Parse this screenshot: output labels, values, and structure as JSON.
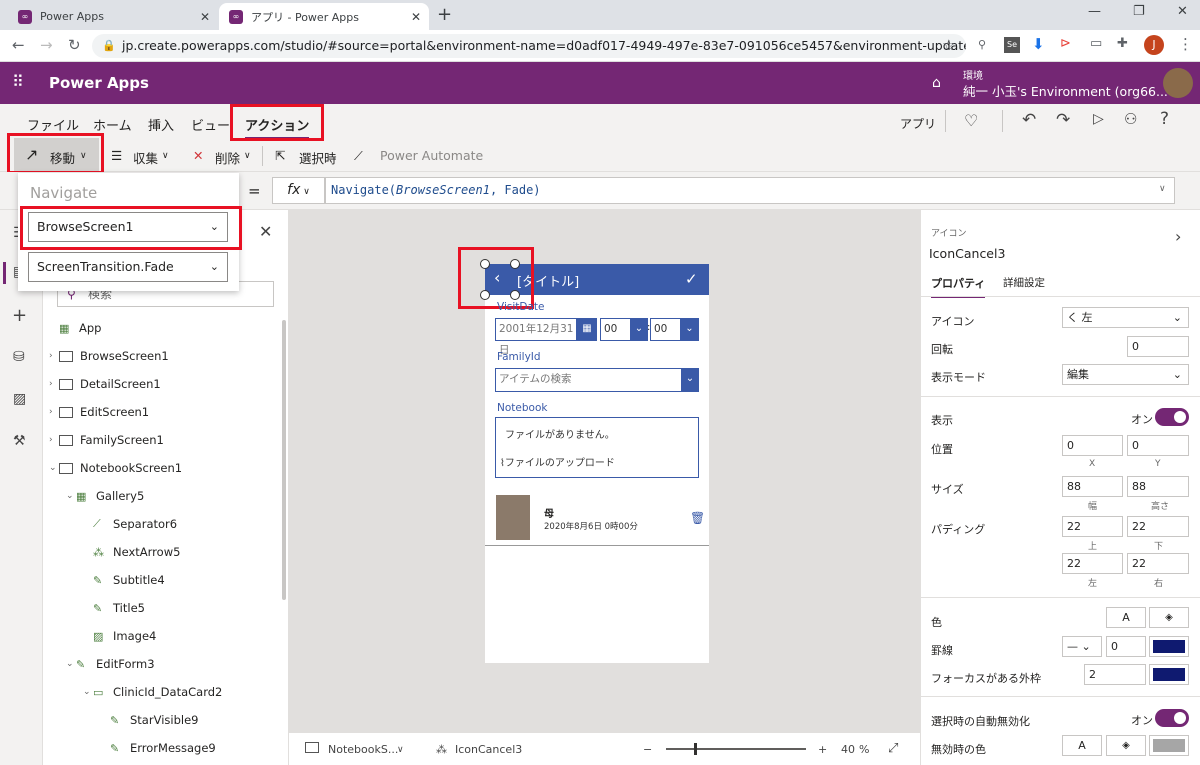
{
  "browser": {
    "tabs": [
      {
        "title": "Power Apps"
      },
      {
        "title": "アプリ - Power Apps"
      }
    ],
    "url": "jp.create.powerapps.com/studio/#source=portal&environment-name=d0adf017-4949-497e-83e7-091056ce5457&environment-update-cadence=...",
    "profile_initial": "J"
  },
  "header": {
    "app_title": "Power Apps",
    "env_label": "環境",
    "env_name": "純一 小玉's Environment (org66..."
  },
  "menu": {
    "items": [
      "ファイル",
      "ホーム",
      "挿入",
      "ビュー",
      "アクション"
    ],
    "right_label": "アプリ"
  },
  "toolbar": {
    "navigate": "移動",
    "collect": "収集",
    "delete": "削除",
    "onselect": "選択時",
    "power_automate": "Power Automate"
  },
  "formula": {
    "eq": "=",
    "fx": "fx",
    "func": "Navigate(",
    "arg1": "BrowseScreen1",
    "rest": ", Fade)"
  },
  "navigate_dropdown": {
    "heading": "Navigate",
    "screen": "BrowseScreen1",
    "transition": "ScreenTransition.Fade"
  },
  "tree": {
    "search_placeholder": "検索",
    "rows": [
      {
        "label": "App",
        "indent": 0,
        "chev": ""
      },
      {
        "label": "BrowseScreen1",
        "indent": 0,
        "chev": "›"
      },
      {
        "label": "DetailScreen1",
        "indent": 0,
        "chev": "›"
      },
      {
        "label": "EditScreen1",
        "indent": 0,
        "chev": "›"
      },
      {
        "label": "FamilyScreen1",
        "indent": 0,
        "chev": "›"
      },
      {
        "label": "NotebookScreen1",
        "indent": 0,
        "chev": "⌄"
      },
      {
        "label": "Gallery5",
        "indent": 1,
        "chev": "⌄"
      },
      {
        "label": "Separator6",
        "indent": 2,
        "chev": ""
      },
      {
        "label": "NextArrow5",
        "indent": 2,
        "chev": ""
      },
      {
        "label": "Subtitle4",
        "indent": 2,
        "chev": ""
      },
      {
        "label": "Title5",
        "indent": 2,
        "chev": ""
      },
      {
        "label": "Image4",
        "indent": 2,
        "chev": ""
      },
      {
        "label": "EditForm3",
        "indent": 1,
        "chev": "⌄"
      },
      {
        "label": "ClinicId_DataCard2",
        "indent": 2,
        "chev": "⌄"
      },
      {
        "label": "StarVisible9",
        "indent": 3,
        "chev": ""
      },
      {
        "label": "ErrorMessage9",
        "indent": 3,
        "chev": ""
      }
    ]
  },
  "phone": {
    "title": "[タイトル]",
    "visitdate_label": "VisitDate",
    "date_value": "2001年12月31日",
    "hour": "00",
    "minute": "00",
    "familyid_label": "FamilyId",
    "familyid_placeholder": "アイテムの検索",
    "notebook_label": "Notebook",
    "no_files": "ファイルがありません。",
    "upload": "ファイルのアップロード",
    "gallery_title": "母",
    "gallery_subtitle": "2020年8月6日 0時00分"
  },
  "status": {
    "screen": "NotebookS...",
    "control": "IconCancel3",
    "zoom": "40",
    "zoom_unit": "%",
    "zoom_level": 0.4
  },
  "props": {
    "category": "アイコン",
    "control_name": "IconCancel3",
    "tab_properties": "プロパティ",
    "tab_advanced": "詳細設定",
    "icon_label": "アイコン",
    "icon_value": "く 左",
    "rotation_label": "回転",
    "rotation_value": "0",
    "displaymode_label": "表示モード",
    "displaymode_value": "編集",
    "visible_label": "表示",
    "on": "オン",
    "position_label": "位置",
    "x_value": "0",
    "y_value": "0",
    "x_label": "X",
    "y_label": "Y",
    "size_label": "サイズ",
    "width_value": "88",
    "height_value": "88",
    "width_label": "幅",
    "height_label": "高さ",
    "padding_label": "パディング",
    "pad_top": "22",
    "pad_bottom": "22",
    "pad_left": "22",
    "pad_right": "22",
    "top_label": "上",
    "bottom_label": "下",
    "left_label": "左",
    "right_label": "右",
    "color_label": "色",
    "border_label": "罫線",
    "border_width": "0",
    "focus_label": "フォーカスがある外枠",
    "focus_value": "2",
    "autodisable_label": "選択時の自動無効化",
    "disabled_color_label": "無効時の色",
    "color_a": "A",
    "border_color": "#0f1a70",
    "accent": "#742774",
    "brand_blue": "#3a5aa8"
  }
}
